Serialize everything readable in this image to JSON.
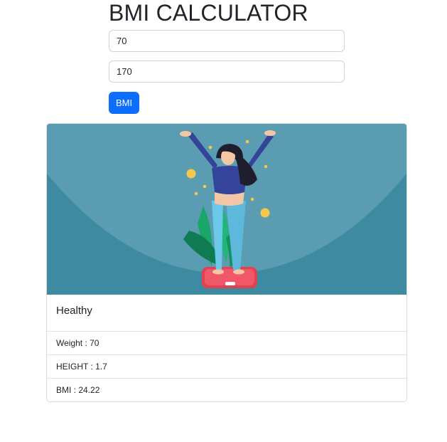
{
  "header": {
    "title": "BMI CALCULATOR"
  },
  "form": {
    "weight_value": "70",
    "height_value": "170",
    "button_label": "BMI"
  },
  "result": {
    "status": "Healthy",
    "items": [
      {
        "text": "Weight : 70"
      },
      {
        "text": "HEIGHT : 1.7"
      },
      {
        "text": "BMI : 24.22"
      }
    ]
  },
  "colors": {
    "primary_button": "#0d6efd",
    "illustration_bg": "#3e8aa0",
    "illustration_arc": "#5c9fb4"
  },
  "illustration": {
    "icon": "woman-on-scale-illustration"
  }
}
